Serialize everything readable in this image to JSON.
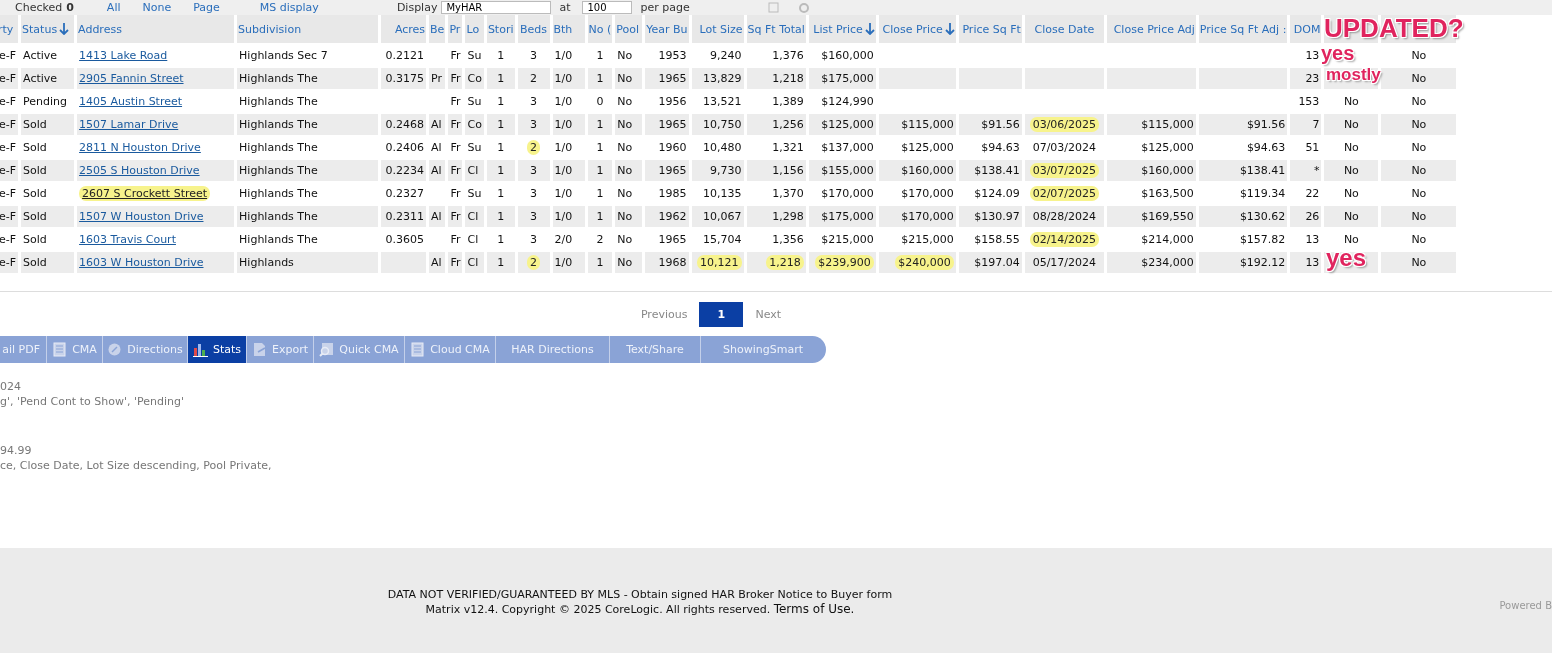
{
  "top_bar": {
    "checked_label": "Checked",
    "checked_count": "0",
    "links": [
      "All",
      "None",
      "Page",
      "MS display"
    ],
    "display_label": "Display",
    "display_value": "MyHAR",
    "at_label": "at",
    "per_page_value": "100",
    "per_page_label": "per page"
  },
  "table": {
    "columns": [
      {
        "label": "rty",
        "kind": "text",
        "sorted": false
      },
      {
        "label": "Status",
        "kind": "text",
        "sorted": true
      },
      {
        "label": "Address",
        "kind": "link",
        "sorted": false
      },
      {
        "label": "Subdivision",
        "kind": "text",
        "sorted": false
      },
      {
        "label": "Acres",
        "kind": "number",
        "sorted": false
      },
      {
        "label": "Be",
        "kind": "text",
        "sorted": false
      },
      {
        "label": "Pr",
        "kind": "text",
        "sorted": false
      },
      {
        "label": "Lo",
        "kind": "text",
        "sorted": false
      },
      {
        "label": "Stori",
        "kind": "center",
        "sorted": false
      },
      {
        "label": "Beds",
        "kind": "center",
        "sorted": false
      },
      {
        "label": "Bth",
        "kind": "text",
        "sorted": false
      },
      {
        "label": "No (",
        "kind": "center",
        "sorted": false
      },
      {
        "label": "Pool",
        "kind": "text",
        "sorted": false
      },
      {
        "label": "Year Bu",
        "kind": "number",
        "sorted": false
      },
      {
        "label": "Lot Size",
        "kind": "number",
        "sorted": false
      },
      {
        "label": "Sq Ft Total",
        "kind": "number",
        "sorted": false
      },
      {
        "label": "List Price",
        "kind": "number",
        "sorted": true
      },
      {
        "label": "Close Price",
        "kind": "number",
        "sorted": true
      },
      {
        "label": "Price Sq Ft",
        "kind": "number",
        "sorted": false
      },
      {
        "label": "Close Date",
        "kind": "center",
        "sorted": false
      },
      {
        "label": "Close Price Adj",
        "kind": "number",
        "sorted": false
      },
      {
        "label": "Price Sq Ft Adj :",
        "kind": "number",
        "sorted": false
      },
      {
        "label": "DOM",
        "kind": "number",
        "sorted": false
      },
      {
        "kind": "center"
      },
      {
        "kind": "center"
      }
    ],
    "rows": [
      [
        "e-F",
        "Active",
        "1413 Lake Road",
        "Highlands Sec 7",
        "0.2121",
        null,
        "Fr",
        "Su",
        "1",
        "3",
        "1/0",
        "1",
        "No",
        "1953",
        "9,240",
        "1,376",
        "$160,000",
        null,
        null,
        null,
        null,
        null,
        "13",
        null,
        "No"
      ],
      [
        "e-F",
        "Active",
        "2905 Fannin Street",
        "Highlands The",
        "0.3175",
        "Pr",
        "Fr",
        "Co",
        "1",
        "2",
        "1/0",
        "1",
        "No",
        "1965",
        "13,829",
        "1,218",
        "$175,000",
        null,
        null,
        null,
        null,
        null,
        "23",
        null,
        "No"
      ],
      [
        "e-F",
        "Pending",
        "1405 Austin Street",
        "Highlands The",
        null,
        null,
        "Fr",
        "Su",
        "1",
        "3",
        "1/0",
        "0",
        "No",
        "1956",
        "13,521",
        "1,389",
        "$124,990",
        null,
        null,
        null,
        null,
        null,
        "153",
        "No",
        "No"
      ],
      [
        "e-F",
        "Sold",
        "1507 Lamar Drive",
        "Highlands The",
        "0.2468",
        "Al",
        "Fr",
        "Co",
        "1",
        "3",
        "1/0",
        "1",
        "No",
        "1965",
        "10,750",
        "1,256",
        "$125,000",
        "$115,000",
        "$91.56",
        {
          "text": "03/06/2025",
          "highlighted": true
        },
        "$115,000",
        "$91.56",
        "7",
        "No",
        "No"
      ],
      [
        "e-F",
        "Sold",
        "2811 N Houston Drive",
        "Highlands The",
        "0.2406",
        "Al",
        "Fr",
        "Su",
        "1",
        {
          "text": "2",
          "highlighted": true
        },
        "1/0",
        "1",
        "No",
        "1960",
        "10,480",
        "1,321",
        "$137,000",
        "$125,000",
        "$94.63",
        "07/03/2024",
        "$125,000",
        "$94.63",
        "51",
        "No",
        "No"
      ],
      [
        "e-F",
        "Sold",
        "2505 S Houston Drive",
        "Highlands The",
        "0.2234",
        "Al",
        "Fr",
        "Cl",
        "1",
        "3",
        "1/0",
        "1",
        "No",
        "1965",
        "9,730",
        "1,156",
        "$155,000",
        "$160,000",
        "$138.41",
        {
          "text": "03/07/2025",
          "highlighted": true
        },
        "$160,000",
        "$138.41",
        "*",
        "No",
        "No"
      ],
      [
        "e-F",
        "Sold",
        {
          "text": "2607 S Crockett Street",
          "highlighted": true
        },
        "Highlands The",
        "0.2327",
        null,
        "Fr",
        "Su",
        "1",
        "3",
        "1/0",
        "1",
        "No",
        "1985",
        "10,135",
        "1,370",
        "$170,000",
        "$170,000",
        "$124.09",
        {
          "text": "02/07/2025",
          "highlighted": true
        },
        "$163,500",
        "$119.34",
        "22",
        "No",
        "No"
      ],
      [
        "e-F",
        "Sold",
        "1507 W Houston Drive",
        "Highlands The",
        "0.2311",
        "Al",
        "Fr",
        "Cl",
        "1",
        "3",
        "1/0",
        "1",
        "No",
        "1962",
        "10,067",
        "1,298",
        "$175,000",
        "$170,000",
        "$130.97",
        "08/28/2024",
        "$169,550",
        "$130.62",
        "26",
        "No",
        "No"
      ],
      [
        "e-F",
        "Sold",
        "1603 Travis Court",
        "Highlands The",
        "0.3605",
        null,
        "Fr",
        "Cl",
        "1",
        "3",
        "2/0",
        "2",
        "No",
        "1965",
        "15,704",
        "1,356",
        "$215,000",
        "$215,000",
        "$158.55",
        {
          "text": "02/14/2025",
          "highlighted": true
        },
        "$214,000",
        "$157.82",
        "13",
        "No",
        "No"
      ],
      [
        "e-F",
        "Sold",
        "1603 W Houston Drive",
        "Highlands",
        null,
        "Al",
        "Fr",
        "Cl",
        "1",
        {
          "text": "2",
          "highlighted": true
        },
        "1/0",
        "1",
        "No",
        "1968",
        {
          "text": "10,121",
          "highlighted": true
        },
        {
          "text": "1,218",
          "highlighted": true
        },
        {
          "text": "$239,900",
          "highlighted": true
        },
        {
          "text": "$240,000",
          "highlighted": true
        },
        "$197.04",
        "05/17/2024",
        "$234,000",
        "$192.12",
        "13",
        null,
        "No"
      ]
    ]
  },
  "pagination": {
    "previous": "Previous",
    "pages": [
      {
        "label": "1",
        "selected": true
      }
    ],
    "next": "Next"
  },
  "toolbar": [
    {
      "label": "ail PDF",
      "selected": false
    },
    {
      "label": "CMA",
      "selected": false
    },
    {
      "label": "Directions",
      "selected": false
    },
    {
      "label": "Stats",
      "selected": true
    },
    {
      "label": "Export",
      "selected": false
    },
    {
      "label": "Quick CMA",
      "selected": false
    },
    {
      "label": "Cloud CMA",
      "selected": false
    },
    {
      "label": "HAR Directions",
      "selected": false
    },
    {
      "label": "Text/Share",
      "selected": false
    },
    {
      "label": "ShowingSmart",
      "selected": false
    }
  ],
  "criteria_lines": [
    "024",
    "g', 'Pend Cont to Show', 'Pending'",
    "94.99",
    "ce, Close Date, Lot Size descending, Pool Private,"
  ],
  "footer": {
    "disclaimer": "DATA NOT VERIFIED/GUARANTEED BY MLS - Obtain signed HAR Broker Notice to Buyer form",
    "copyright": "Matrix v12.4. Copyright © 2025 CoreLogic. All rights reserved.",
    "terms_link": "Terms of Use.",
    "powered_by": "Powered B"
  },
  "annotations": [
    {
      "text": "UPDATED?"
    },
    {
      "text": "yes"
    },
    {
      "text": "mostly"
    },
    {
      "text": "yes"
    }
  ]
}
